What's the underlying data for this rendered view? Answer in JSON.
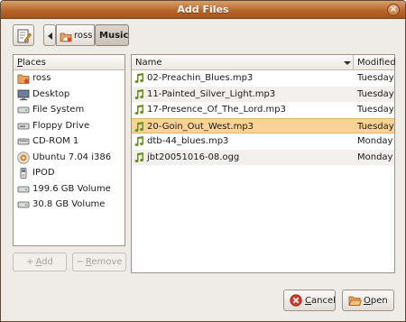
{
  "window": {
    "title": "Add Files",
    "close_glyph": "×"
  },
  "toolbar": {
    "edit_icon": "edit-location-icon",
    "back_icon": "left-arrow-icon",
    "crumbs": [
      {
        "label": "ross",
        "icon": "home-folder-icon"
      },
      {
        "label": "Music",
        "active": true
      }
    ]
  },
  "places": {
    "header_underlined": "P",
    "header_rest": "laces",
    "items": [
      {
        "label": "ross",
        "icon": "home-folder-icon"
      },
      {
        "label": "Desktop",
        "icon": "desktop-icon"
      },
      {
        "label": "File System",
        "icon": "harddisk-icon"
      },
      {
        "label": "Floppy Drive",
        "icon": "floppy-icon"
      },
      {
        "label": "CD-ROM 1",
        "icon": "cdrom-icon"
      },
      {
        "label": "Ubuntu 7.04 i386",
        "icon": "cd-disc-icon"
      },
      {
        "label": "IPOD",
        "icon": "ipod-icon"
      },
      {
        "label": "199.6 GB Volume",
        "icon": "harddisk-icon"
      },
      {
        "label": "30.8 GB Volume",
        "icon": "harddisk-icon"
      }
    ],
    "add_button": {
      "symbol": "+",
      "underlined": "A",
      "rest": "dd"
    },
    "remove_button": {
      "symbol": "−",
      "underlined": "R",
      "rest": "emove"
    }
  },
  "files": {
    "columns": {
      "name": "Name",
      "modified": "Modified"
    },
    "rows": [
      {
        "name": "02-Preachin_Blues.mp3",
        "modified": "Tuesday",
        "icon": "music-note-icon"
      },
      {
        "name": "11-Painted_Silver_Light.mp3",
        "modified": "Tuesday",
        "icon": "music-note-icon"
      },
      {
        "name": "17-Presence_Of_The_Lord.mp3",
        "modified": "Tuesday",
        "icon": "music-note-icon"
      },
      {
        "name": "20-Goin_Out_West.mp3",
        "modified": "Tuesday",
        "icon": "music-note-icon",
        "selected": true
      },
      {
        "name": "dtb-44_blues.mp3",
        "modified": "Monday",
        "icon": "music-note-icon"
      },
      {
        "name": "jbt20051016-08.ogg",
        "modified": "Monday",
        "icon": "music-note-icon"
      }
    ]
  },
  "buttons": {
    "cancel": {
      "underlined": "C",
      "rest": "ancel"
    },
    "open": {
      "underlined": "O",
      "rest": "pen"
    }
  },
  "colors": {
    "titlebar": "#b8672c",
    "selection": "#f7d39a",
    "note_icon": "#6f8f2a"
  }
}
